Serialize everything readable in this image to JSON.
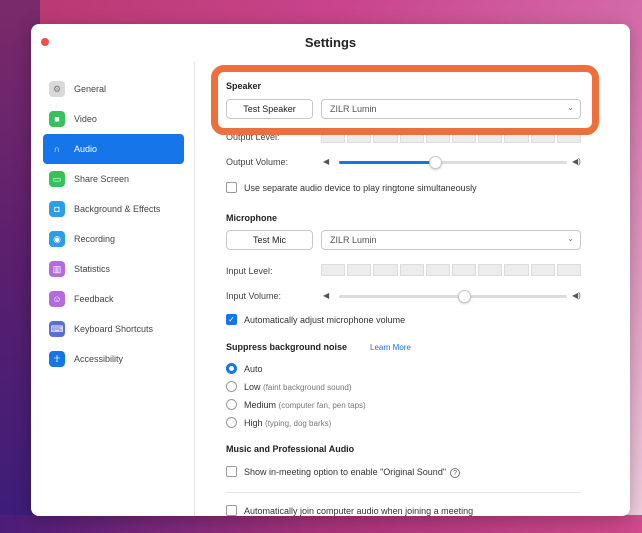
{
  "window": {
    "title": "Settings"
  },
  "sidebar": {
    "items": [
      {
        "label": "General",
        "icon": "gear-icon",
        "color": "#d9d9d9",
        "active": false
      },
      {
        "label": "Video",
        "icon": "video-icon",
        "color": "#35c25a",
        "active": false
      },
      {
        "label": "Audio",
        "icon": "headphones-icon",
        "color": "#1675e8",
        "active": true
      },
      {
        "label": "Share Screen",
        "icon": "share-screen-icon",
        "color": "#35c25a",
        "active": false
      },
      {
        "label": "Background & Effects",
        "icon": "background-icon",
        "color": "#2a9ee8",
        "active": false
      },
      {
        "label": "Recording",
        "icon": "recording-icon",
        "color": "#2a9ee8",
        "active": false
      },
      {
        "label": "Statistics",
        "icon": "statistics-icon",
        "color": "#b46ae0",
        "active": false
      },
      {
        "label": "Feedback",
        "icon": "feedback-icon",
        "color": "#b46ae0",
        "active": false
      },
      {
        "label": "Keyboard Shortcuts",
        "icon": "keyboard-icon",
        "color": "#5b6ed8",
        "active": false
      },
      {
        "label": "Accessibility",
        "icon": "accessibility-icon",
        "color": "#1675e8",
        "active": false
      }
    ]
  },
  "speaker": {
    "heading": "Speaker",
    "test_button": "Test Speaker",
    "device": "ZILR Lumin",
    "output_level_label": "Output Level:",
    "output_volume_label": "Output Volume:",
    "output_volume": 0.42
  },
  "ringtone_checkbox": {
    "label": "Use separate audio device to play ringtone simultaneously",
    "checked": false
  },
  "microphone": {
    "heading": "Microphone",
    "test_button": "Test Mic",
    "device": "ZILR Lumin",
    "input_level_label": "Input Level:",
    "input_volume_label": "Input Volume:",
    "input_volume": 0.55
  },
  "auto_adjust_checkbox": {
    "label": "Automatically adjust microphone volume",
    "checked": true
  },
  "suppress": {
    "heading": "Suppress background noise",
    "learn_more": "Learn More",
    "options": [
      {
        "label": "Auto",
        "hint": "",
        "selected": true
      },
      {
        "label": "Low",
        "hint": "(faint background sound)",
        "selected": false
      },
      {
        "label": "Medium",
        "hint": "(computer fan, pen taps)",
        "selected": false
      },
      {
        "label": "High",
        "hint": "(typing, dog barks)",
        "selected": false
      }
    ]
  },
  "music": {
    "heading": "Music and Professional Audio",
    "original_sound_label": "Show in-meeting option to enable \"Original Sound\"",
    "original_sound_checked": false
  },
  "auto_join_checkbox": {
    "label": "Automatically join computer audio when joining a meeting",
    "checked": false
  },
  "highlight_color": "#ef6f3c",
  "accent_color": "#1675e8"
}
